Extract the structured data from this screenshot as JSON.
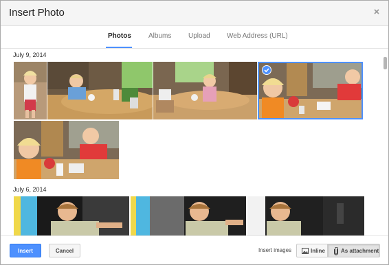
{
  "dialog": {
    "title": "Insert Photo",
    "close_icon": "close-icon"
  },
  "tabs": [
    {
      "label": "Photos",
      "active": true
    },
    {
      "label": "Albums",
      "active": false
    },
    {
      "label": "Upload",
      "active": false
    },
    {
      "label": "Web Address (URL)",
      "active": false
    }
  ],
  "sections": [
    {
      "date": "July 9, 2014"
    },
    {
      "date": "July 6, 2014"
    }
  ],
  "footer": {
    "insert_label": "Insert",
    "cancel_label": "Cancel",
    "insert_images_label": "Insert images",
    "inline_label": "Inline",
    "attachment_label": "As attachment",
    "inline_icon": "image-icon",
    "attachment_icon": "paperclip-icon"
  },
  "colors": {
    "accent": "#4d90fe",
    "accent_border": "#3079ed"
  }
}
